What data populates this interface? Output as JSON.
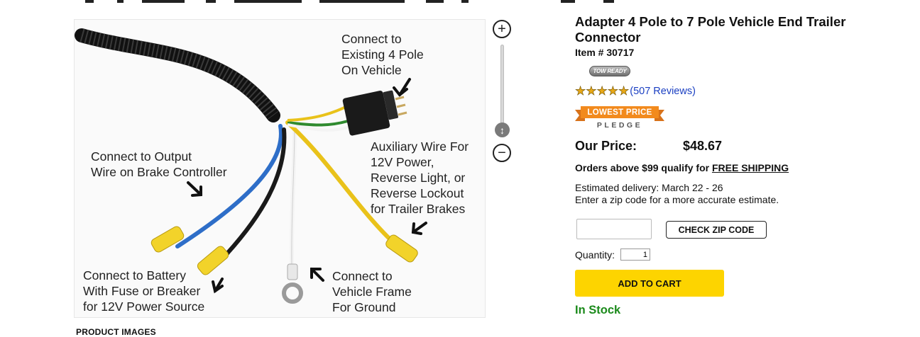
{
  "image": {
    "annotations": [
      "Connect to\nExisting 4 Pole\nOn Vehicle",
      "Connect to Output\nWire on Brake Controller",
      "Auxiliary Wire For\n12V Power,\nReverse Light, or\nReverse Lockout\nfor Trailer Brakes",
      "Connect to Battery\nWith Fuse or Breaker\nfor 12V Power Source",
      "Connect to\nVehicle Frame\nFor Ground"
    ]
  },
  "zoom": {
    "in_icon": "plus-icon",
    "out_icon": "minus-icon",
    "handle_icon": "vertical-arrows-icon"
  },
  "gallery": {
    "label": "PRODUCT IMAGES"
  },
  "product": {
    "title": "Adapter 4 Pole to 7 Pole Vehicle End Trailer Connector",
    "item_number": "Item # 30717",
    "tow_badge": "TOW READY",
    "rating": 4.5,
    "reviews": "(507 Reviews)",
    "lowest_price_badge": {
      "ribbon": "LOWEST PRICE",
      "sub": "PLEDGE",
      "color": "#f28a1d"
    },
    "price_label": "Our Price:",
    "price": "$48.67",
    "shipping_prefix": "Orders above $99 qualify for ",
    "shipping_link": "FREE SHIPPING",
    "delivery_line1": "Estimated delivery: March 22 - 26",
    "delivery_line2": "Enter a zip code for a more accurate estimate.",
    "zip_value": "",
    "zip_button": "CHECK ZIP CODE",
    "quantity_label": "Quantity:",
    "quantity_value": "1",
    "add_to_cart": "ADD TO CART",
    "add_to_cart_color": "#fdd400",
    "stock": "In Stock",
    "stock_color": "#1b8a1b"
  }
}
